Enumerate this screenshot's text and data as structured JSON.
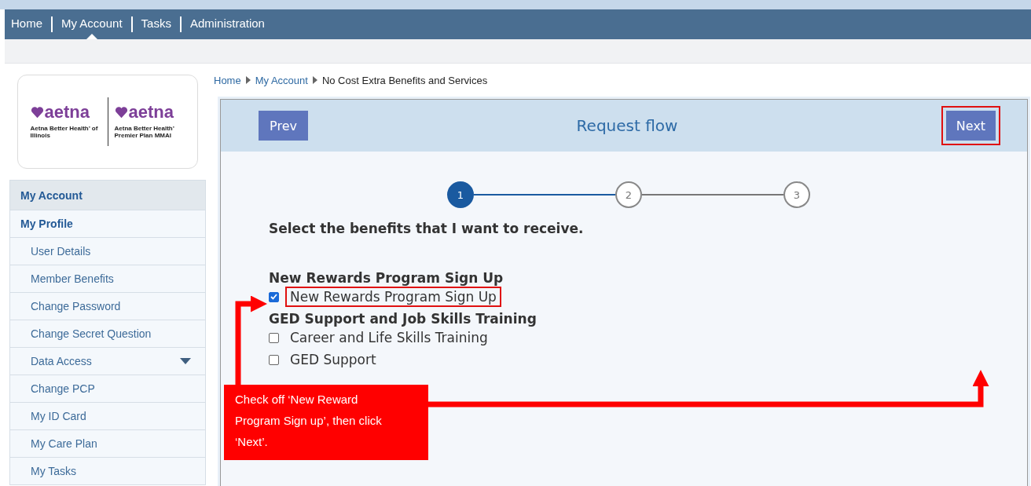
{
  "nav": [
    {
      "label": "Home",
      "selected": false
    },
    {
      "label": "My Account",
      "selected": true
    },
    {
      "label": "Tasks",
      "selected": false
    },
    {
      "label": "Administration",
      "selected": false
    }
  ],
  "logo": {
    "left": {
      "brand": "aetna",
      "subtitle": "Aetna Better Health’ of Illinois"
    },
    "right": {
      "brand": "aetna",
      "subtitle": "Aetna Better Health’ Premier Plan MMAI"
    }
  },
  "sidebar": {
    "items": [
      {
        "label": "My Account",
        "kind": "header"
      },
      {
        "label": "My Profile",
        "kind": "section"
      },
      {
        "label": "User Details",
        "kind": "item"
      },
      {
        "label": "Member Benefits",
        "kind": "item"
      },
      {
        "label": "Change Password",
        "kind": "item"
      },
      {
        "label": "Change Secret Question",
        "kind": "item"
      },
      {
        "label": "Data Access",
        "kind": "dropdown"
      },
      {
        "label": "Change PCP",
        "kind": "item"
      },
      {
        "label": "My ID Card",
        "kind": "item"
      },
      {
        "label": "My Care Plan",
        "kind": "item"
      },
      {
        "label": "My Tasks",
        "kind": "item"
      }
    ]
  },
  "breadcrumb": [
    {
      "label": "Home",
      "kind": "link"
    },
    {
      "label": "My Account",
      "kind": "link"
    },
    {
      "label": "No Cost Extra Benefits and Services",
      "kind": "current"
    }
  ],
  "panel": {
    "title": "Request flow",
    "prev_button": {
      "label": "Prev"
    },
    "next_button": {
      "label": "Next",
      "highlighted": true
    },
    "steps": [
      {
        "label": "1",
        "selected": true
      },
      {
        "label": "2",
        "selected": false
      },
      {
        "label": "3",
        "selected": false
      }
    ],
    "prompt": "Select the benefits that I want to receive.",
    "groups": [
      {
        "title": "New Rewards Program Sign Up",
        "options": [
          {
            "label": "New Rewards Program Sign Up",
            "checked": true,
            "highlighted": true
          }
        ]
      },
      {
        "title": "GED Support and Job Skills Training",
        "options": [
          {
            "label": "Career and Life Skills Training",
            "checked": false,
            "highlighted": false
          },
          {
            "label": "GED Support",
            "checked": false,
            "highlighted": false
          }
        ]
      }
    ]
  },
  "callout": {
    "text": "Check off ‘New Reward Program Sign up’, then click ‘Next’."
  }
}
